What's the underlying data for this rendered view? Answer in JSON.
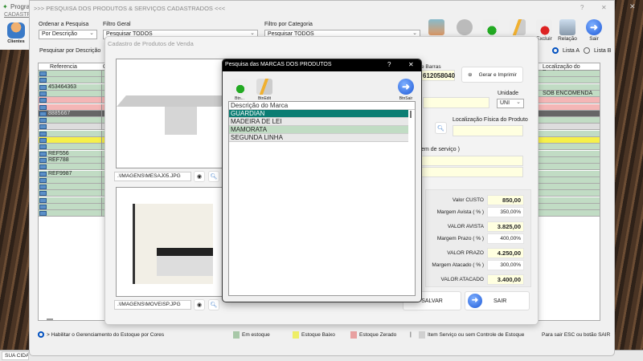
{
  "background_app": {
    "title": "Progra",
    "menu": "CADASTR",
    "clientes_label": "Clientes",
    "status_city": "SUA CIDAD"
  },
  "main_window": {
    "title": ">>>  PESQUISA DOS PRODUTOS & SERVIÇOS CADASTRADOS  <<<",
    "help": "?",
    "close": "✕",
    "ordenar_label": "Ordenar a Pesquisa",
    "ordenar_value": "Por Descrição",
    "filtro_geral_label": "Filtro Geral",
    "filtro_geral_value": "Pesquisar TODOS",
    "filtro_categoria_label": "Filtro por Categoria",
    "filtro_categoria_value": "Pesquisar TODOS",
    "toolbar": [
      {
        "label": "",
        "icon": "image-icon"
      },
      {
        "label": "",
        "icon": "barcode-icon"
      },
      {
        "label": "",
        "icon": "add-document-icon"
      },
      {
        "label": "",
        "icon": "edit-document-icon"
      },
      {
        "label": "Excluir",
        "icon": "delete-icon"
      },
      {
        "label": "Relação",
        "icon": "printer-icon"
      },
      {
        "label": "Sair",
        "icon": "exit-arrow-icon"
      }
    ],
    "search_label": "Pesquisar por Descrição",
    "radio_a": "Lista A",
    "radio_b": "Lista B",
    "radio_selected": "Lista A",
    "grid": {
      "col_ref": "Referencia",
      "col_c": "C",
      "col_loc": "Localização do Produto",
      "rows": [
        {
          "ref": "",
          "loc": "",
          "s": "g"
        },
        {
          "ref": "",
          "loc": "",
          "s": "g"
        },
        {
          "ref": "453464363",
          "loc": "",
          "s": "g"
        },
        {
          "ref": "",
          "loc": "SOB ENCOMENDA",
          "s": "g"
        },
        {
          "ref": "",
          "loc": "",
          "s": "r"
        },
        {
          "ref": "",
          "loc": "",
          "s": "r"
        },
        {
          "ref": "8885667",
          "loc": "",
          "s": "d"
        },
        {
          "ref": "",
          "loc": "",
          "s": "g"
        },
        {
          "ref": "",
          "loc": "",
          "s": "l"
        },
        {
          "ref": "",
          "loc": "",
          "s": "g"
        },
        {
          "ref": "",
          "loc": "",
          "s": "y"
        },
        {
          "ref": "",
          "loc": "",
          "s": "g"
        },
        {
          "ref": "REF556",
          "loc": "",
          "s": "g"
        },
        {
          "ref": "REF788",
          "loc": "",
          "s": "g"
        },
        {
          "ref": "",
          "loc": "",
          "s": "g"
        },
        {
          "ref": "REF9987",
          "loc": "",
          "s": "g"
        },
        {
          "ref": "",
          "loc": "",
          "s": "g"
        },
        {
          "ref": "",
          "loc": "",
          "s": "g"
        },
        {
          "ref": "",
          "loc": "",
          "s": "g"
        },
        {
          "ref": "",
          "loc": "",
          "s": "g"
        },
        {
          "ref": "",
          "loc": "",
          "s": "g"
        },
        {
          "ref": "",
          "loc": "",
          "s": "g"
        }
      ]
    },
    "footer": {
      "habilitar": "> Habilitar o Gerenciamento do Estoque por Cores",
      "em_estoque": "Em estoque",
      "estoque_baixo": "Estoque Baixo",
      "estoque_zerado": "Estoque Zerado",
      "sep": "|",
      "item_servico": "Item Serviço ou sem Controle de Estoque",
      "sair_hint": "Para sair ESC ou botão SAIR"
    },
    "legend_colors": {
      "em_estoque": "#a8c8a8",
      "estoque_baixo": "#eeee66",
      "estoque_zerado": "#e8a0a0",
      "item_servico": "#d0d0d0"
    }
  },
  "cadastro": {
    "title": "Cadastro de Produtos de Venda",
    "image1_path": ".\\IMAGENS\\MESAJ05.JPG",
    "image2_path": ".\\IMAGENS\\MOVEISP.JPG",
    "barras_label": "e Barras",
    "barras_value": "612058040",
    "gerar_button": "Gerar e Imprimir",
    "unidade_label": "Unidade",
    "unidade_value": "UNI",
    "localizacao_label": "Localização Física do Produto",
    "ordem_label": "ordem de serviço )",
    "pricing": [
      {
        "label": "Valor CUSTO",
        "value": "850,00",
        "bold": true
      },
      {
        "label": "Margem Avista ( % )",
        "value": "350,00%",
        "bold": false
      },
      {
        "label": "VALOR AVISTA",
        "value": "3.825,00",
        "bold": true
      },
      {
        "label": "Margem Prazo ( % )",
        "value": "400,00%",
        "bold": false
      },
      {
        "label": "VALOR PRAZO",
        "value": "4.250,00",
        "bold": true
      },
      {
        "label": "Margem Atacado ( % )",
        "value": "300,00%",
        "bold": false
      },
      {
        "label": "VALOR ATACADO",
        "value": "3.400,00",
        "bold": true
      }
    ],
    "salvar_button": "SALVAR",
    "sair_button": "SAIR"
  },
  "marcas_dialog": {
    "title": "Pesquisa das MARCAS DOS PRODUTOS",
    "help": "?",
    "close": "✕",
    "btn_new": "Btn...",
    "btn_edit": "BtnEdit",
    "btn_exit": "BtnSair",
    "header": "Descrição do Marca",
    "items": [
      "GUARDIAN",
      "MADEIRA DE LEI",
      "MAMORATA",
      "SEGUNDA LINHA"
    ],
    "selected": "GUARDIAN"
  }
}
